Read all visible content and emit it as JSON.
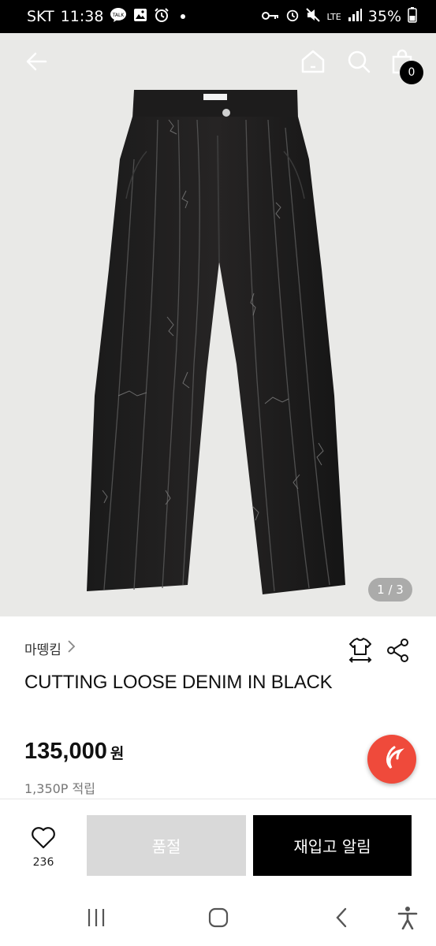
{
  "status_bar": {
    "carrier": "SKT",
    "time": "11:38",
    "talk_label": "TALK",
    "network": "LTE",
    "battery": "35%"
  },
  "header": {
    "cart_count": "0"
  },
  "gallery": {
    "pager": "1 / 3"
  },
  "product": {
    "brand": "마뗑킴",
    "title": "CUTTING LOOSE DENIM IN BLACK",
    "price": "135,000",
    "price_unit": "원",
    "points": "1,350P 적립"
  },
  "actions": {
    "like_count": "236",
    "soldout_label": "품절",
    "restock_label": "재입고 알림"
  },
  "colors": {
    "fab": "#ef4a3b",
    "primary_button": "#000000",
    "disabled_button": "#d9d9d9",
    "hero_bg": "#e9e9e7"
  },
  "icons": [
    "back-arrow-icon",
    "home-icon",
    "search-icon",
    "shopping-bag-icon",
    "size-guide-icon",
    "share-icon",
    "heart-icon",
    "fab-logo-icon",
    "recent-apps-icon",
    "home-nav-icon",
    "back-nav-icon",
    "accessibility-icon"
  ]
}
